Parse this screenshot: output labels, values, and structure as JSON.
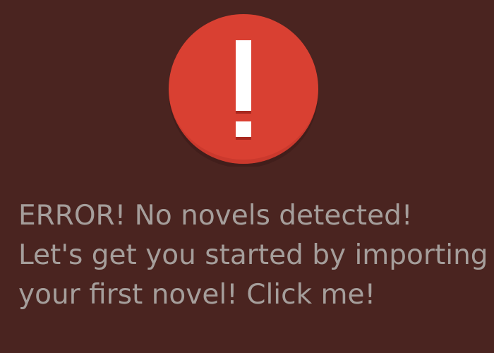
{
  "theme": {
    "background": "#4a2420",
    "text_color": "#a59e9b",
    "icon_circle_color": "#d94032",
    "icon_mark_color": "#ffffff"
  },
  "error_icon": {
    "name": "exclamation-icon"
  },
  "message": {
    "line1": "ERROR! No novels detected!",
    "line2": "Let's get you started by importing",
    "line3": "your first novel! Click me!"
  }
}
